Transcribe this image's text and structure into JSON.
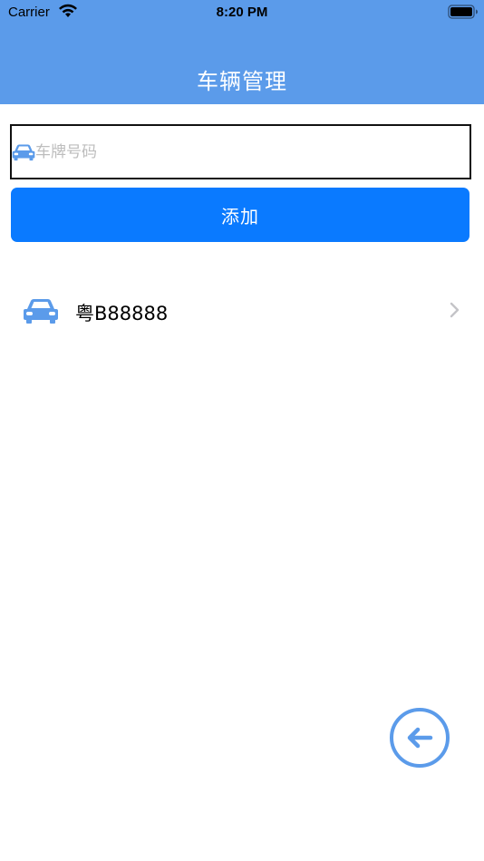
{
  "status_bar": {
    "carrier": "Carrier",
    "time": "8:20 PM",
    "wifi_icon": "wifi-icon",
    "battery_icon": "battery-icon"
  },
  "nav": {
    "title": "车辆管理"
  },
  "form": {
    "plate_placeholder": "车牌号码",
    "plate_value": "",
    "input_icon": "car-icon",
    "add_label": "添加"
  },
  "vehicles": [
    {
      "plate": "粤B88888",
      "icon": "car-icon",
      "chevron": "chevron-right-icon"
    }
  ],
  "fab": {
    "icon": "arrow-left-circle-icon"
  },
  "colors": {
    "nav_background": "#5b9bea",
    "primary_button": "#0a7aff",
    "icon_accent": "#5b9bea"
  }
}
